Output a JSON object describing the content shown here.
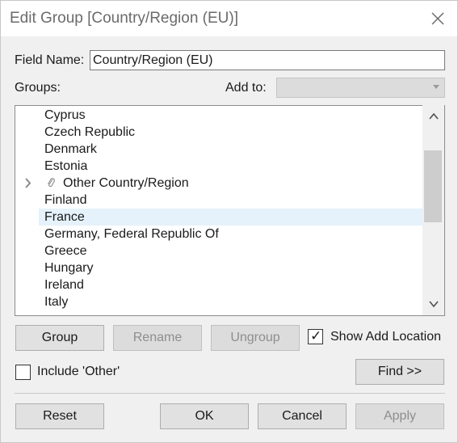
{
  "window": {
    "title": "Edit Group [Country/Region (EU)]",
    "close_icon": "close-icon"
  },
  "field_name": {
    "label": "Field Name:",
    "value": "Country/Region (EU)"
  },
  "groups_label": "Groups:",
  "add_to": {
    "label": "Add to:",
    "value": ""
  },
  "list": {
    "items": [
      {
        "label": "Cyprus",
        "type": "item"
      },
      {
        "label": "Czech Republic",
        "type": "item"
      },
      {
        "label": "Denmark",
        "type": "item"
      },
      {
        "label": "Estonia",
        "type": "item"
      },
      {
        "label": "Other Country/Region",
        "type": "group",
        "chevron": "›",
        "clip": "⌀"
      },
      {
        "label": "Finland",
        "type": "item"
      },
      {
        "label": "France",
        "type": "item",
        "selected": true
      },
      {
        "label": "Germany, Federal Republic Of",
        "type": "item"
      },
      {
        "label": "Greece",
        "type": "item"
      },
      {
        "label": "Hungary",
        "type": "item"
      },
      {
        "label": "Ireland",
        "type": "item"
      },
      {
        "label": "Italy",
        "type": "item"
      }
    ],
    "scroll_up_glyph": "︿",
    "scroll_down_glyph": "﹀"
  },
  "buttons": {
    "group": "Group",
    "rename": "Rename",
    "ungroup": "Ungroup",
    "find": "Find >>",
    "reset": "Reset",
    "ok": "OK",
    "cancel": "Cancel",
    "apply": "Apply"
  },
  "checkboxes": {
    "show_add_location": {
      "label": "Show Add Location",
      "checked": true
    },
    "include_other": {
      "label": "Include 'Other'",
      "checked": false
    }
  },
  "check_glyph": "✓"
}
